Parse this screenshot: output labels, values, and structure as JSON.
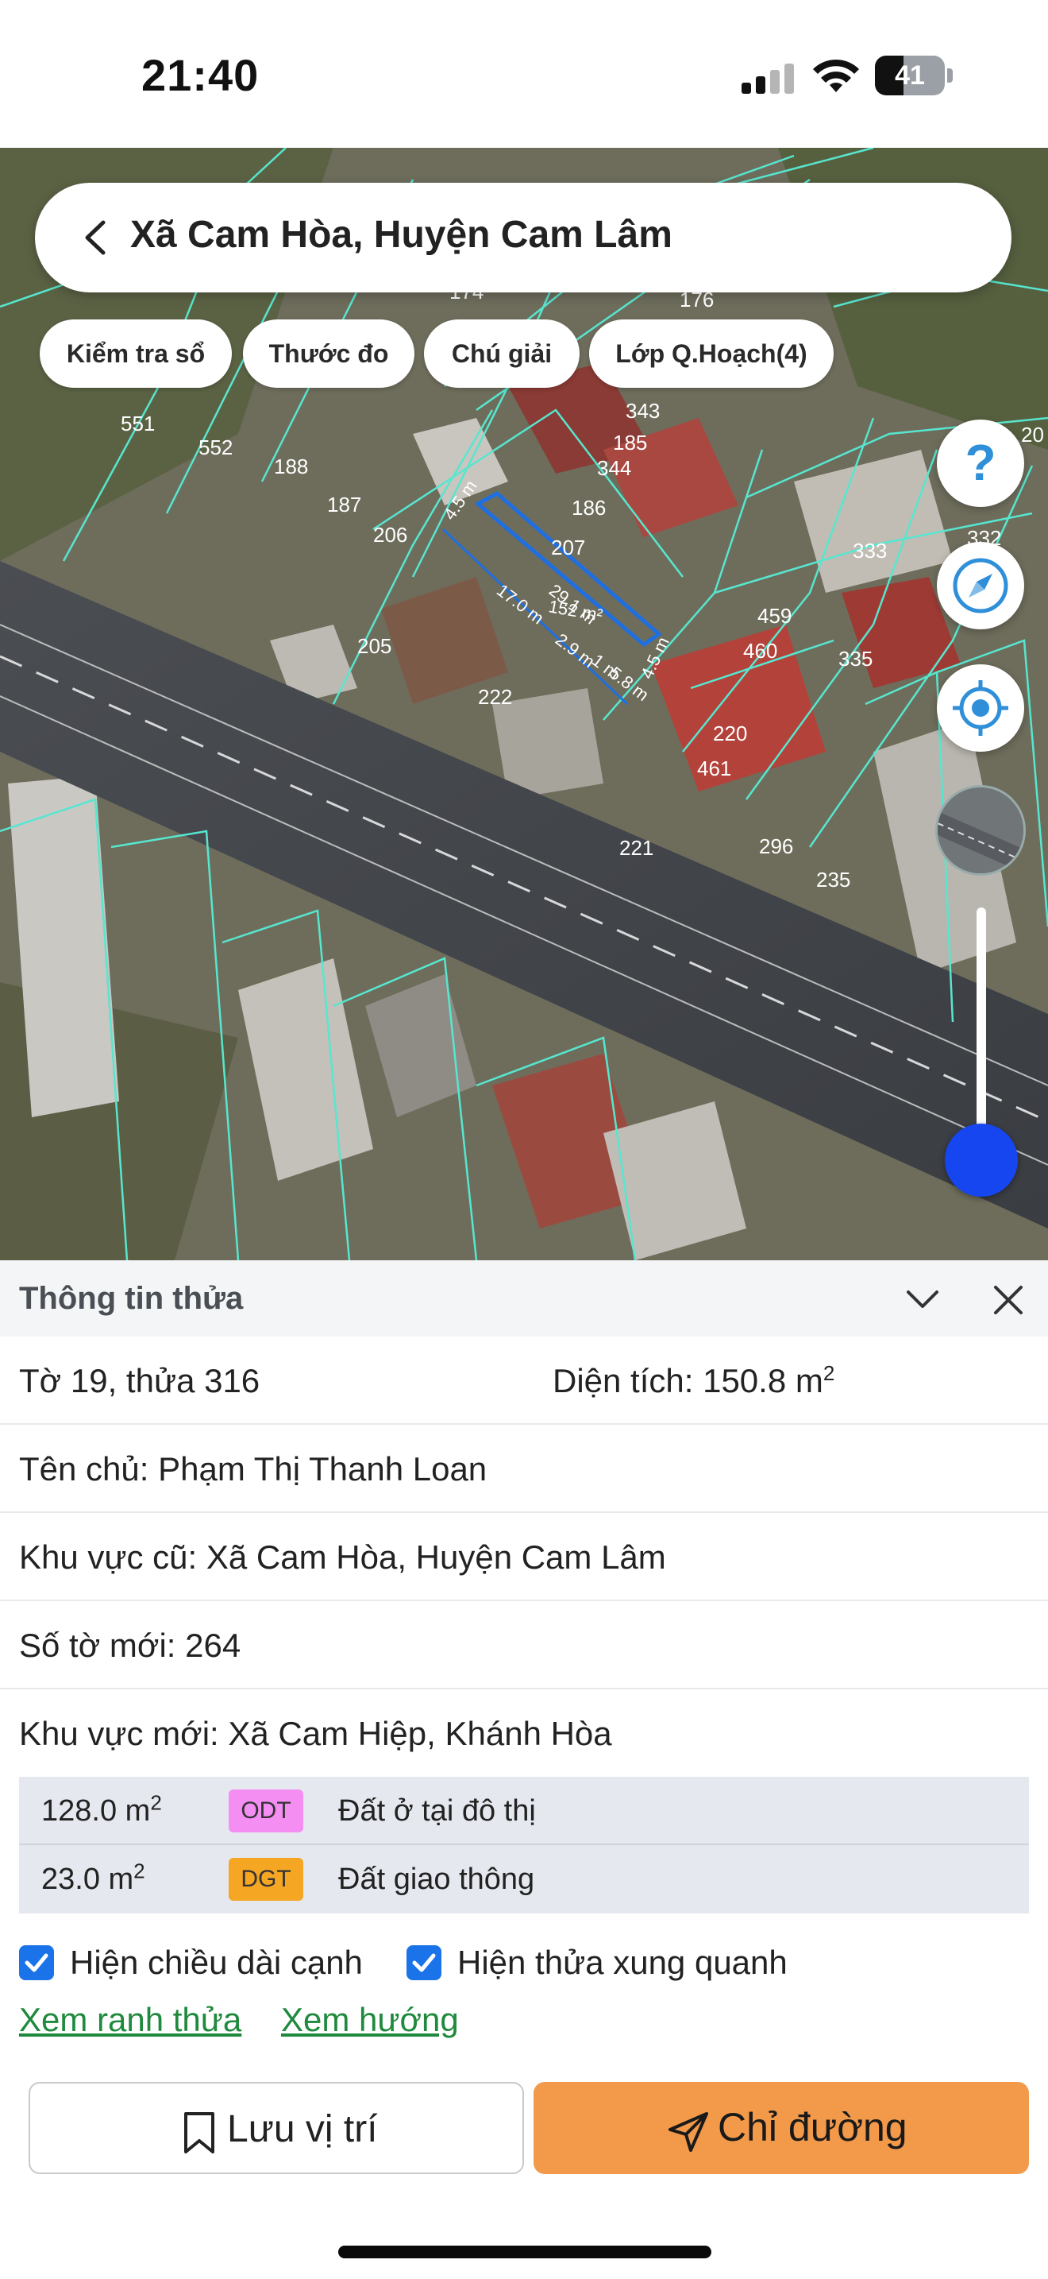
{
  "status_bar": {
    "time": "21:40",
    "battery": "41",
    "battery_level": 0.41
  },
  "search": {
    "title": "Xã Cam Hòa, Huyện Cam Lâm"
  },
  "chips": [
    "Kiểm tra sổ",
    "Thước đo",
    "Chú giải",
    "Lớp Q.Hoạch(4)"
  ],
  "map": {
    "zoom_level": 0.95,
    "plot_labels": [
      "551",
      "552",
      "188",
      "187",
      "206",
      "205",
      "222",
      "176",
      "174",
      "343",
      "185",
      "344",
      "186",
      "207",
      "459",
      "460",
      "335",
      "333",
      "220",
      "461",
      "221",
      "296",
      "235",
      "332",
      "20"
    ],
    "measurements": [
      "4.5 m",
      "29.1 m",
      "152 m²",
      "17.0 m",
      "2.9 m",
      "1 m",
      "5.8 m",
      "4.5 m"
    ]
  },
  "panel": {
    "title": "Thông tin thửa",
    "sheet_parcel": "Tờ 19, thửa 316",
    "area_label": "Diện tích: 150.8 m",
    "area_sup": "2",
    "owner": "Tên chủ: Phạm Thị Thanh Loan",
    "old_area": "Khu vực cũ: Xã Cam Hòa, Huyện Cam Lâm",
    "new_sheet": "Số tờ mới: 264",
    "new_area": "Khu vực mới: Xã Cam Hiệp, Khánh Hòa",
    "land_uses": [
      {
        "area": "128.0 m",
        "sup": "2",
        "code": "ODT",
        "color": "#f48ef2",
        "desc": "Đất ở tại đô thị"
      },
      {
        "area": "23.0 m",
        "sup": "2",
        "code": "DGT",
        "color": "#f5a623",
        "desc": "Đất giao thông"
      }
    ],
    "checkboxes": [
      {
        "label": "Hiện chiều dài cạnh",
        "checked": true
      },
      {
        "label": "Hiện thửa xung quanh",
        "checked": true
      }
    ],
    "links": [
      "Xem ranh thửa",
      "Xem hướng"
    ],
    "save_label": "Lưu vị trí",
    "directions_label": "Chỉ đường"
  }
}
